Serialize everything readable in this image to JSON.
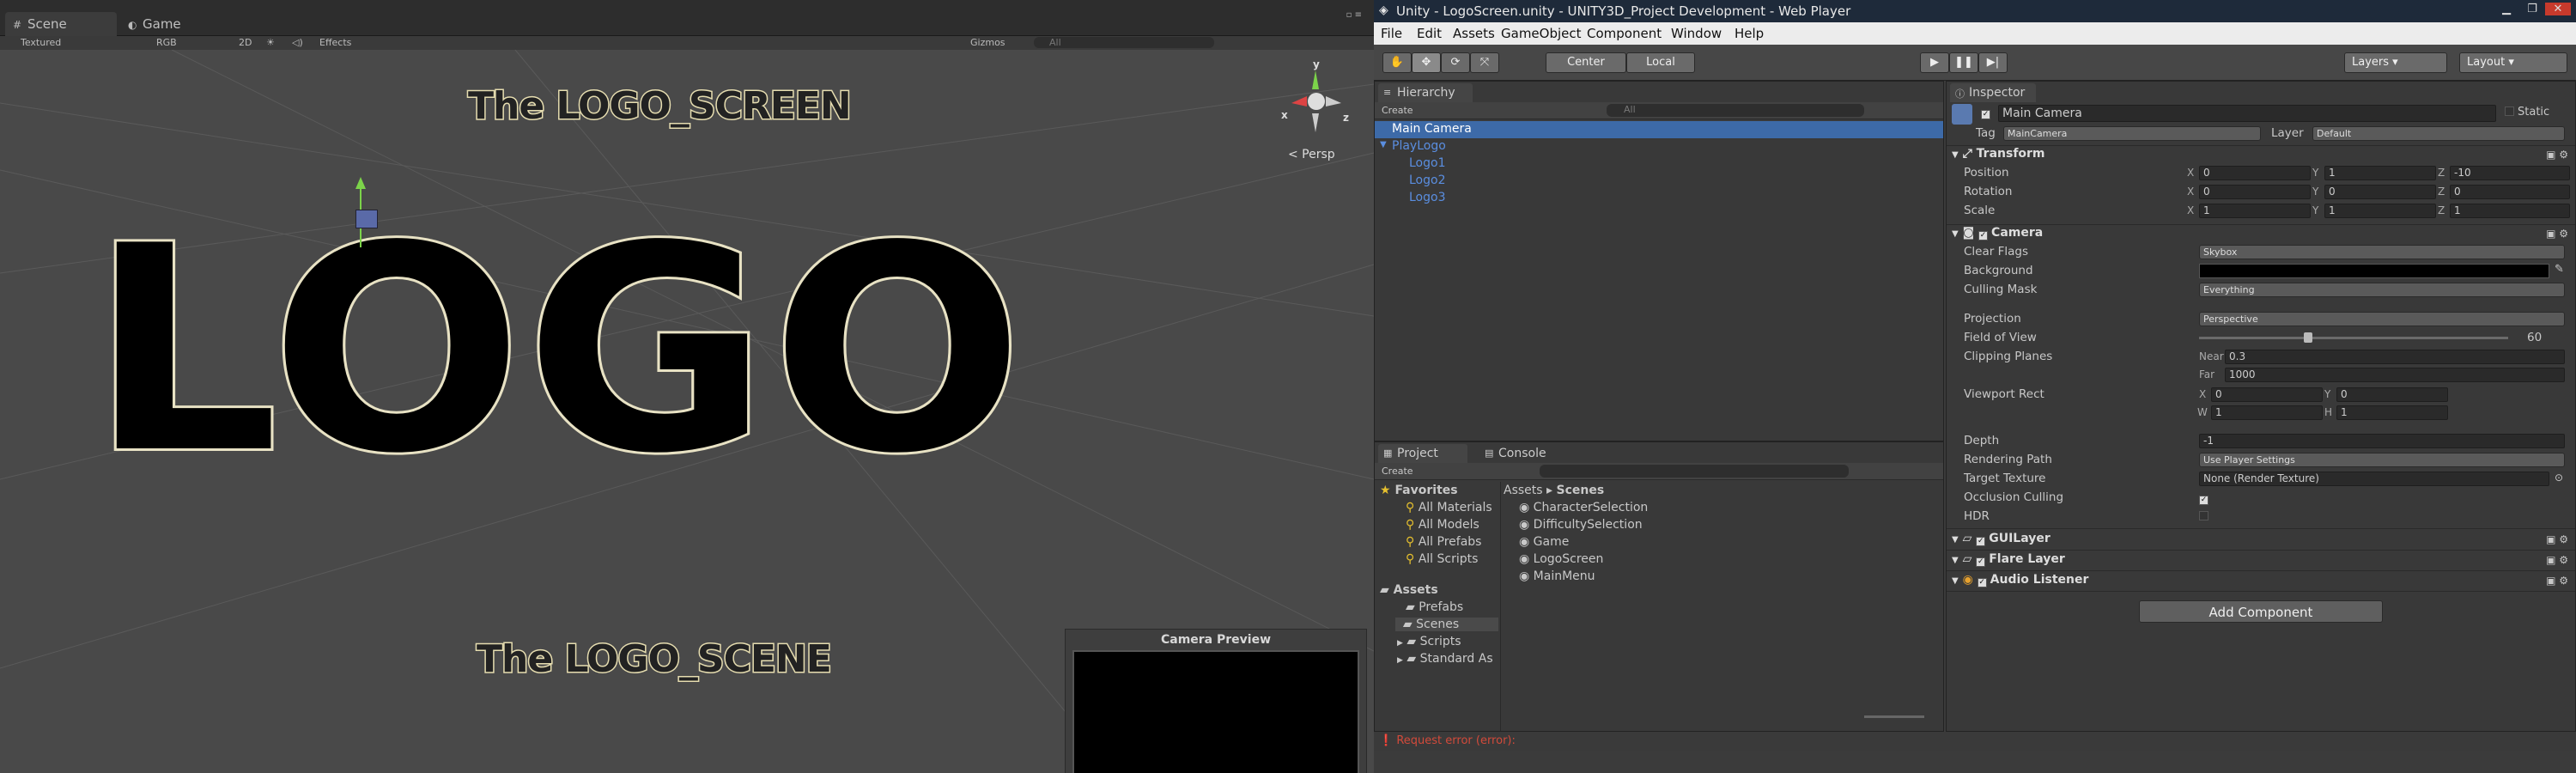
{
  "scene_window": {
    "tabs": [
      {
        "label": "Scene",
        "icon": "scene-icon"
      },
      {
        "label": "Game",
        "icon": "game-icon"
      }
    ],
    "toolbar": {
      "render_mode": "Textured",
      "color_mode": "RGB",
      "mode_2d": "2D",
      "effects": "Effects",
      "gizmos": "Gizmos",
      "search": "All"
    },
    "gizmo_label": "< Persp",
    "texts": {
      "logo": "LOGO",
      "top_label": "The LOGO_SCREEN",
      "bottom_label": "The LOGO_SCENE"
    },
    "camera_preview": "Camera Preview"
  },
  "window": {
    "title": "Unity - LogoScreen.unity - UNITY3D_Project Development - Web Player"
  },
  "menu": [
    "File",
    "Edit",
    "Assets",
    "GameObject",
    "Component",
    "Window",
    "Help"
  ],
  "toolbar": {
    "pivot": "Center",
    "space": "Local",
    "layers": "Layers",
    "layout": "Layout"
  },
  "hierarchy": {
    "title": "Hierarchy",
    "create": "Create",
    "search": "All",
    "items": [
      {
        "label": "Main Camera"
      },
      {
        "label": "PlayLogo"
      },
      {
        "label": "Logo1"
      },
      {
        "label": "Logo2"
      },
      {
        "label": "Logo3"
      }
    ]
  },
  "project": {
    "tabs": [
      "Project",
      "Console"
    ],
    "create": "Create",
    "favorites": {
      "label": "Favorites",
      "items": [
        "All Materials",
        "All Models",
        "All Prefabs",
        "All Scripts"
      ]
    },
    "assets": {
      "label": "Assets",
      "items": [
        "Prefabs",
        "Scenes",
        "Scripts",
        "Standard As"
      ]
    },
    "breadcrumb": {
      "root": "Assets",
      "sep": "▸",
      "current": "Scenes"
    },
    "files": [
      "CharacterSelection",
      "DifficultySelection",
      "Game",
      "LogoScreen",
      "MainMenu"
    ]
  },
  "inspector": {
    "title": "Inspector",
    "object_name": "Main Camera",
    "static_label": "Static",
    "tag_label": "Tag",
    "tag_value": "MainCamera",
    "layer_label": "Layer",
    "layer_value": "Default",
    "transform": {
      "title": "Transform",
      "rows": [
        {
          "label": "Position",
          "x": "0",
          "y": "1",
          "z": "-10"
        },
        {
          "label": "Rotation",
          "x": "0",
          "y": "0",
          "z": "0"
        },
        {
          "label": "Scale",
          "x": "1",
          "y": "1",
          "z": "1"
        }
      ]
    },
    "camera": {
      "title": "Camera",
      "clear_flags": {
        "label": "Clear Flags",
        "value": "Skybox"
      },
      "background": {
        "label": "Background"
      },
      "culling_mask": {
        "label": "Culling Mask",
        "value": "Everything"
      },
      "projection": {
        "label": "Projection",
        "value": "Perspective"
      },
      "fov": {
        "label": "Field of View",
        "value": "60"
      },
      "clipping": {
        "label": "Clipping Planes",
        "near_label": "Near",
        "near": "0.3",
        "far_label": "Far",
        "far": "1000"
      },
      "viewport": {
        "label": "Viewport Rect",
        "x": "0",
        "y": "0",
        "w": "1",
        "h": "1"
      },
      "depth": {
        "label": "Depth",
        "value": "-1"
      },
      "rendering_path": {
        "label": "Rendering Path",
        "value": "Use Player Settings"
      },
      "target_texture": {
        "label": "Target Texture",
        "value": "None (Render Texture)"
      },
      "occlusion": {
        "label": "Occlusion Culling"
      },
      "hdr": {
        "label": "HDR"
      }
    },
    "components": [
      "GUILayer",
      "Flare Layer",
      "Audio Listener"
    ],
    "add_component": "Add Component"
  },
  "status": "Request error (error):",
  "colors": {
    "selection": "#3d6aa8",
    "link_blue": "#5a8ee0",
    "error": "#d24a3a"
  }
}
